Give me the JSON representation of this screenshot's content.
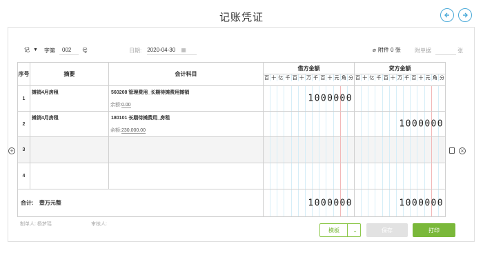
{
  "title": "记账凭证",
  "colors": {
    "accent": "#49a9d8",
    "primary_button": "#7ab83a",
    "disabled_button": "#e2e2e2"
  },
  "header": {
    "voucher_type": "记",
    "number_label": "字第",
    "number_value": "002",
    "number_suffix": "号",
    "date_label": "日期:",
    "date_value": "2020-04-30",
    "attachment_label": "附件 0 张",
    "attachment_docs_label": "附单据",
    "attachment_docs_suffix": "张"
  },
  "table": {
    "col_seq": "序号",
    "col_summary": "摘要",
    "col_account": "会计科目",
    "col_debit": "借方金额",
    "col_credit": "贷方金额",
    "digit_units": [
      "百",
      "十",
      "亿",
      "千",
      "百",
      "十",
      "万",
      "千",
      "百",
      "十",
      "元",
      "角",
      "分"
    ],
    "rows": [
      {
        "seq": "1",
        "summary": "摊销4月房租",
        "account": "560208 管理费用_长期待摊费用摊销",
        "balance_label": "余额:",
        "balance": "0.00",
        "debit": "1000000",
        "credit": ""
      },
      {
        "seq": "2",
        "summary": "摊销4月房租",
        "account": "180101 长期待摊费用_房租",
        "balance_label": "余额:",
        "balance": "230,000.00",
        "debit": "",
        "credit": "1000000"
      },
      {
        "seq": "3",
        "summary": "",
        "account": "",
        "balance_label": "",
        "balance": "",
        "debit": "",
        "credit": ""
      },
      {
        "seq": "4",
        "summary": "",
        "account": "",
        "balance_label": "",
        "balance": "",
        "debit": "",
        "credit": ""
      }
    ],
    "total_label": "合计:",
    "total_words": "壹万元整",
    "total_debit": "1000000",
    "total_credit": "1000000"
  },
  "footer": {
    "maker_label": "制单人: 杨梦瑶",
    "reviewer_label": "审核人:"
  },
  "buttons": {
    "template": "模板",
    "save": "保存",
    "print": "打印"
  },
  "icons": {
    "prev": "arrow-left-icon",
    "next": "arrow-right-icon",
    "attachment": "paperclip-icon",
    "calendar": "calendar-icon",
    "add_row": "plus-circle-icon",
    "copy_row": "copy-icon",
    "delete_row": "close-circle-icon",
    "dropdown": "caret-down-icon"
  }
}
